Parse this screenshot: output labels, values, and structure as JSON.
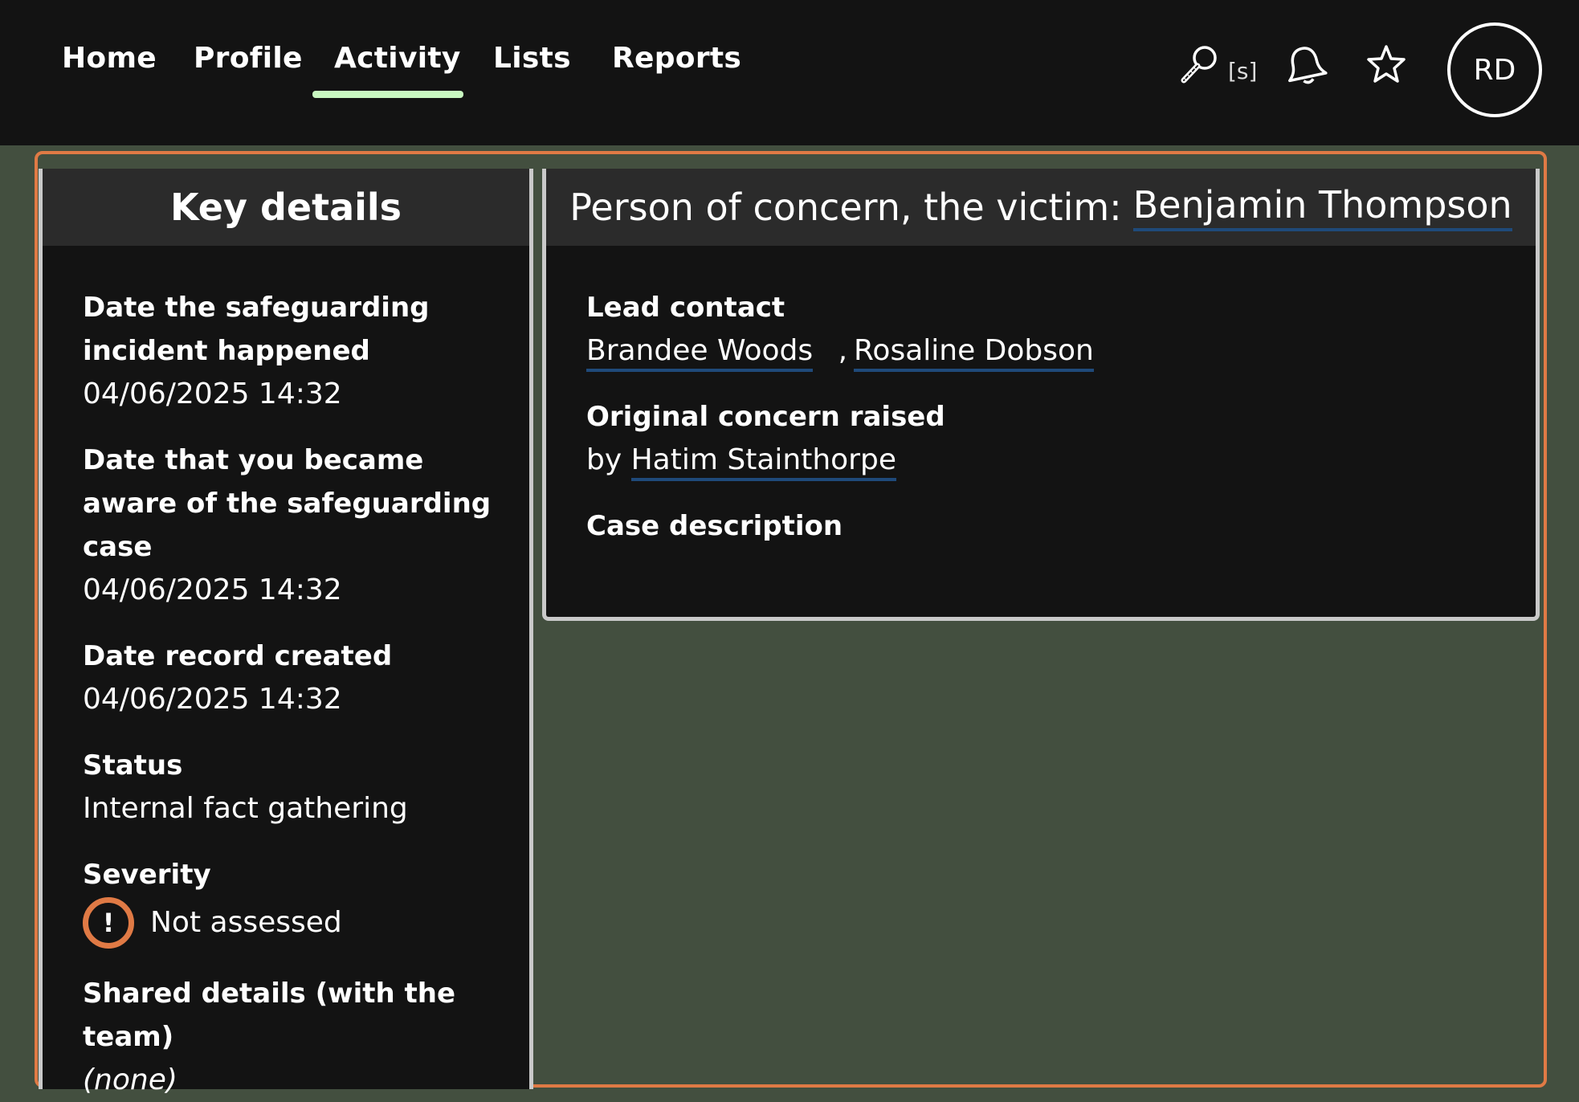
{
  "nav": {
    "items": [
      {
        "label": "Home"
      },
      {
        "label": "Profile"
      },
      {
        "label": "Activity"
      },
      {
        "label": "Lists"
      },
      {
        "label": "Reports"
      }
    ],
    "active": "Activity",
    "search_shortcut": "[s]",
    "avatar_initials": "RD"
  },
  "colors": {
    "focus_outline": "#e07a45",
    "active_underline": "#c8f7c0",
    "link_underline": "#1f4a7a",
    "page_background": "#434f3f"
  },
  "icons": [
    "search-icon",
    "bell-icon",
    "star-icon",
    "exclamation-icon"
  ],
  "key_details": {
    "title": "Key details",
    "incident_date_label": "Date the safeguarding incident happened",
    "incident_date_value": "04/06/2025 14:32",
    "aware_date_label": "Date that you became aware of the safeguarding case",
    "aware_date_value": "04/06/2025 14:32",
    "created_date_label": "Date record created",
    "created_date_value": "04/06/2025 14:32",
    "status_label": "Status",
    "status_value": "Internal fact gathering",
    "severity_label": "Severity",
    "severity_icon_glyph": "!",
    "severity_value": "Not assessed",
    "shared_label": "Shared details (with the team)",
    "shared_value": "(none)"
  },
  "person_panel": {
    "title_prefix": "Person of concern, the victim:",
    "person_name": "Benjamin Thompson",
    "lead_contact_label": "Lead contact",
    "lead_contacts": [
      "Brandee Woods",
      "Rosaline Dobson"
    ],
    "lead_separator": ",",
    "original_concern_label": "Original concern raised",
    "by_prefix": "by",
    "raised_by": "Hatim Stainthorpe",
    "case_description_label": "Case description"
  }
}
